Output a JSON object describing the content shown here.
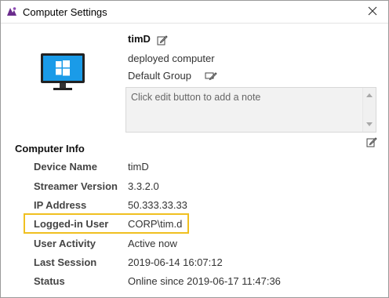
{
  "window": {
    "title": "Computer Settings",
    "icon": "app-logo-icon",
    "close_icon": "close-icon"
  },
  "computer": {
    "name": "timD",
    "description": "deployed computer",
    "group": "Default Group",
    "note_placeholder": "Click edit button to add a note",
    "icon": "windows-monitor-icon"
  },
  "info": {
    "title": "Computer Info",
    "rows": [
      {
        "label": "Device Name",
        "value": "timD"
      },
      {
        "label": "Streamer Version",
        "value": "3.3.2.0"
      },
      {
        "label": "IP Address",
        "value": "50.333.33.33"
      },
      {
        "label": "Logged-in User",
        "value": "CORP\\tim.d"
      },
      {
        "label": "User Activity",
        "value": "Active now"
      },
      {
        "label": "Last Session",
        "value": "2019-06-14 16:07:12"
      },
      {
        "label": "Status",
        "value": "Online since 2019-06-17 11:47:36"
      }
    ],
    "highlighted_row": "Logged-in User"
  },
  "colors": {
    "highlight": "#f0c020",
    "monitor_blue": "#1a9be8",
    "app_icon": "#6a2c8c"
  }
}
